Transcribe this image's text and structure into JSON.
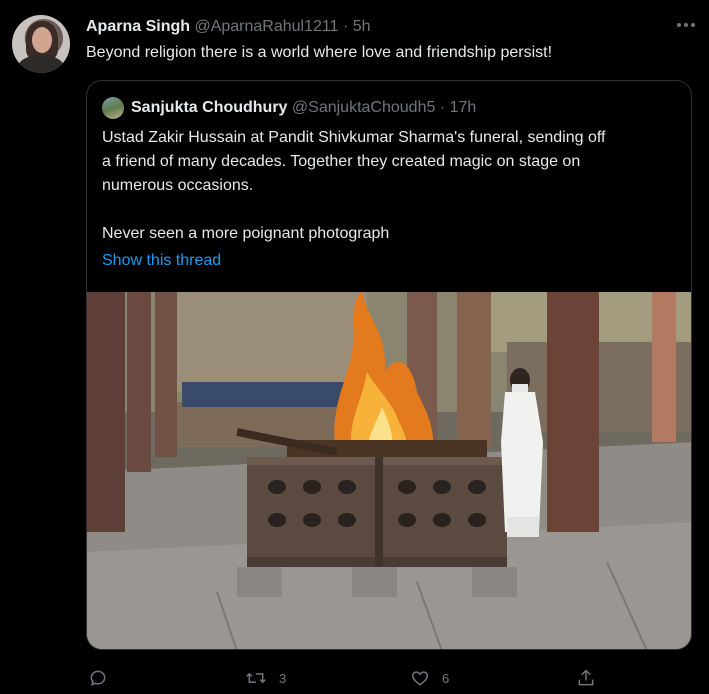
{
  "tweet": {
    "author_name": "Aparna Singh",
    "author_handle": "@AparnaRahul1211",
    "separator": "·",
    "time": "5h",
    "text": "Beyond religion there is a world where love and friendship  persist!"
  },
  "quoted_tweet": {
    "author_name": "Sanjukta Choudhury",
    "author_handle": "@SanjuktaChoudh5",
    "separator": "·",
    "time": "17h",
    "text_lines": [
      "Ustad Zakir Hussain at Pandit Shivkumar Sharma's funeral, sending off",
      "a friend of many decades. Together they created magic on stage on",
      "numerous occasions."
    ],
    "text_second": "Never seen a more poignant photograph",
    "show_thread": "Show this thread"
  },
  "actions": {
    "reply_icon": "reply-icon",
    "retweet_icon": "retweet-icon",
    "retweet_count": "3",
    "like_icon": "heart-icon",
    "like_count": "6",
    "share_icon": "share-icon"
  },
  "colors": {
    "background": "#000000",
    "text": "#e7e9ea",
    "muted": "#71767b",
    "link": "#1d9bf0",
    "border": "#2f3336"
  }
}
